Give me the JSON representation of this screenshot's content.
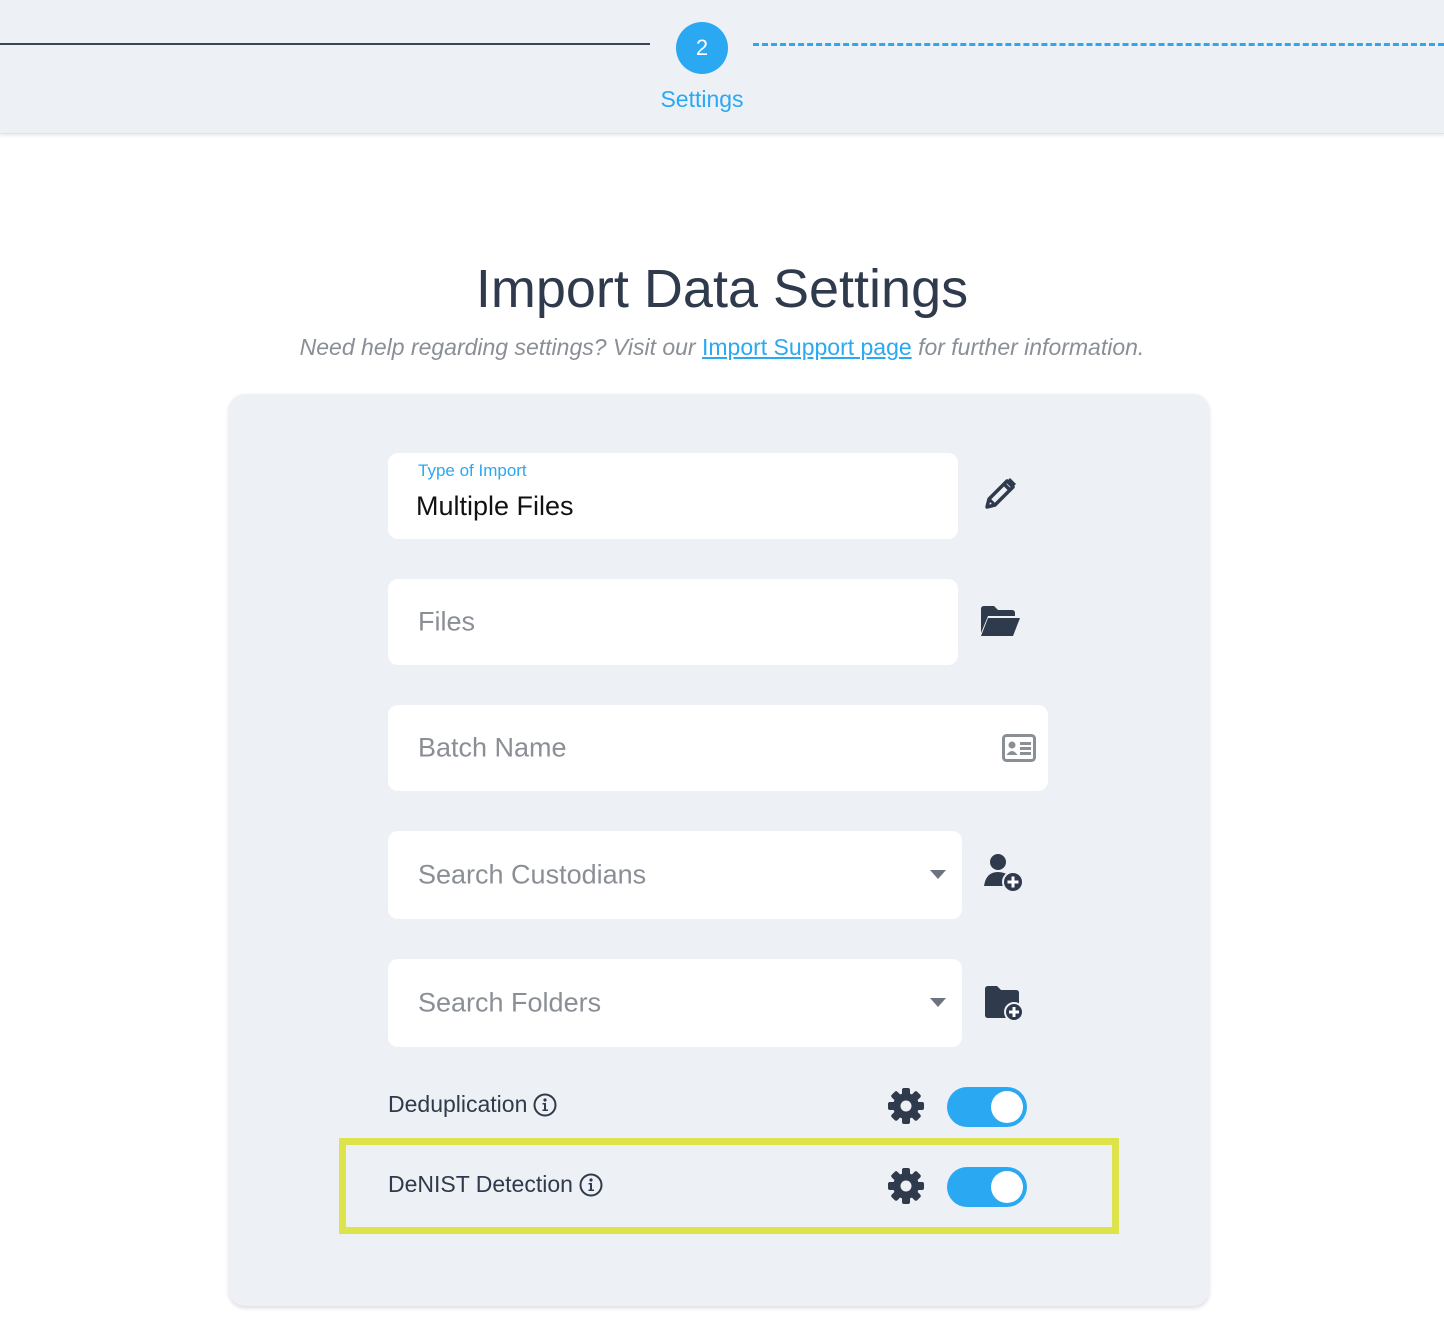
{
  "stepper": {
    "step_number": "2",
    "step_label": "Settings"
  },
  "header": {
    "title": "Import Data Settings",
    "help_prefix": "Need help regarding settings? Visit our",
    "help_link": "Import Support page",
    "help_suffix": "for further information."
  },
  "form": {
    "type_of_import": {
      "label": "Type of Import",
      "value": "Multiple Files"
    },
    "files": {
      "placeholder": "Files"
    },
    "batch_name": {
      "placeholder": "Batch Name"
    },
    "custodians": {
      "placeholder": "Search Custodians"
    },
    "folders": {
      "placeholder": "Search Folders"
    }
  },
  "options": {
    "deduplication": {
      "label": "Deduplication",
      "enabled": true
    },
    "denist": {
      "label": "DeNIST Detection",
      "enabled": true
    }
  },
  "colors": {
    "accent": "#2aa8f2",
    "highlight": "#dde34a",
    "text_dark": "#2f3a4c"
  },
  "icons": [
    "pencil-icon",
    "folder-open-icon",
    "id-card-icon",
    "user-plus-icon",
    "folder-plus-icon",
    "info-icon",
    "gear-icon"
  ]
}
